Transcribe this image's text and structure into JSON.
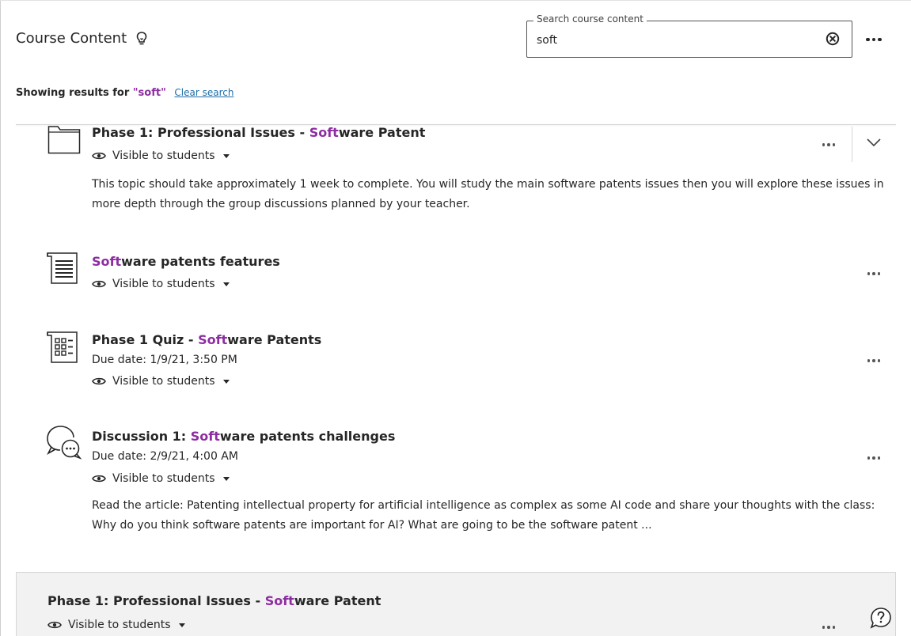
{
  "header": {
    "title": "Course Content"
  },
  "search": {
    "legend": "Search course content",
    "value": "soft"
  },
  "results": {
    "prefix": "Showing results for ",
    "query": "\"soft\"",
    "clear_label": "Clear search"
  },
  "items": [
    {
      "type": "folder",
      "title_pre": "Phase 1: Professional Issues - ",
      "title_hl": "Soft",
      "title_post": "ware Patent",
      "visibility": "Visible to students",
      "description": "This topic should take approximately 1 week to complete. You will study the main software patents issues then you will explore these issues in more depth through the group discussions planned by your teacher."
    },
    {
      "type": "document",
      "title_pre": "",
      "title_hl": "Soft",
      "title_post": "ware patents features",
      "visibility": "Visible to students"
    },
    {
      "type": "test",
      "title_pre": "Phase 1 Quiz - ",
      "title_hl": "Soft",
      "title_post": "ware Patents",
      "due": "Due date: 1/9/21, 3:50 PM",
      "visibility": "Visible to students"
    },
    {
      "type": "discussion",
      "title_pre": "Discussion 1: ",
      "title_hl": "Soft",
      "title_post": "ware patents challenges",
      "due": "Due date: 2/9/21, 4:00 AM",
      "visibility": "Visible to students",
      "description": "Read the article: Patenting intellectual property for artificial intelligence as complex as some AI code and share your thoughts with the class: Why do you think software patents are important for AI? What are going to be the software patent ..."
    },
    {
      "type": "folder",
      "title_pre": "Phase 1: Professional Issues - ",
      "title_hl": "Soft",
      "title_post": "ware Patent",
      "visibility": "Visible to students"
    }
  ],
  "colors": {
    "highlight": "#8d2da1",
    "link": "#1e6ea8",
    "text": "#262626"
  },
  "icons": [
    "lightbulb-icon",
    "clear-circle-x-icon",
    "more-options-icon",
    "folder-icon",
    "document-icon",
    "test-icon",
    "discussion-icon",
    "eye-icon",
    "caret-down-icon",
    "chevron-down-icon",
    "help-icon"
  ]
}
